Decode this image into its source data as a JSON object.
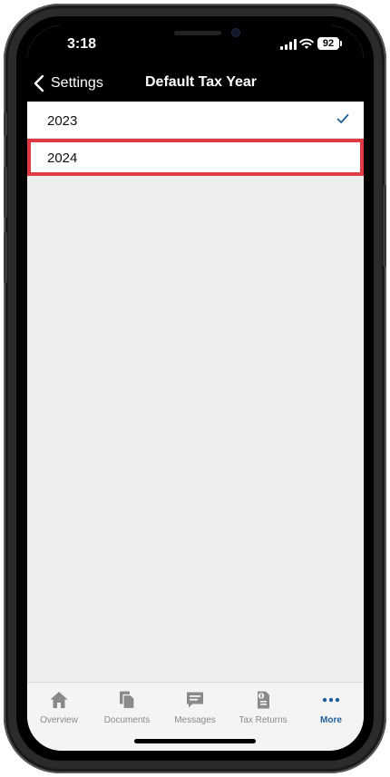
{
  "status_bar": {
    "time": "3:18",
    "battery": "92"
  },
  "nav": {
    "back_label": "Settings",
    "title": "Default Tax Year"
  },
  "years": [
    {
      "label": "2023",
      "selected": true
    },
    {
      "label": "2024",
      "selected": false
    }
  ],
  "tab_bar": {
    "tabs": [
      {
        "label": "Overview",
        "icon": "home-icon"
      },
      {
        "label": "Documents",
        "icon": "documents-icon"
      },
      {
        "label": "Messages",
        "icon": "messages-icon"
      },
      {
        "label": "Tax Returns",
        "icon": "tax-returns-icon"
      },
      {
        "label": "More",
        "icon": "more-icon",
        "active": true
      }
    ]
  },
  "colors": {
    "accent": "#1f5f9a",
    "highlight": "#e03a44"
  }
}
